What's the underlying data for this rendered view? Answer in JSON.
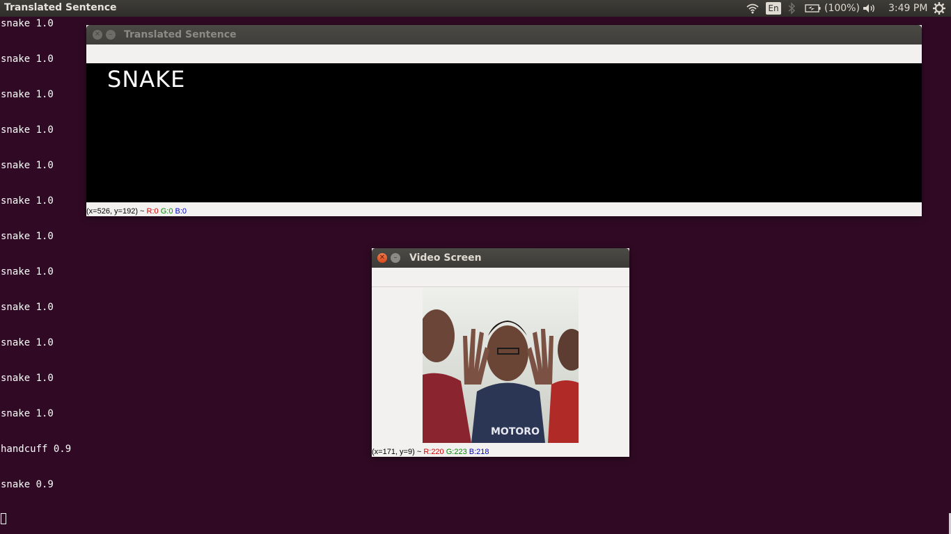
{
  "topbar": {
    "app_title": "Translated Sentence",
    "lang": "En",
    "battery_text": "(100%)",
    "clock": "3:49 PM",
    "icons": [
      "wifi-icon",
      "keyboard-layout-indicator",
      "bluetooth-icon",
      "battery-icon",
      "volume-icon",
      "gear-icon"
    ]
  },
  "terminal": {
    "lines": [
      "snake 1.0",
      "snake 1.0",
      "snake 1.0",
      "snake 1.0",
      "snake 1.0",
      "snake 1.0",
      "snake 1.0",
      "snake 1.0",
      "snake 1.0",
      "snake 1.0",
      "snake 1.0",
      "snake 1.0",
      "handcuff 0.9",
      "snake 0.9"
    ]
  },
  "translated_window": {
    "title": "Translated Sentence",
    "sentence": "SNAKE",
    "status": {
      "coords": "(x=526, y=192) ~",
      "r": "R:0",
      "g": "G:0",
      "b": "B:0"
    }
  },
  "video_window": {
    "title": "Video Screen",
    "shirt_text": "MOTORO",
    "status": {
      "coords": "(x=171, y=9) ~",
      "r": "R:220",
      "g": "G:223",
      "b": "B:218"
    }
  },
  "colors": {
    "desktop": "#300a24",
    "panel": "#3c3b37",
    "window_bg": "#f2f1f0",
    "close_button": "#e05a2b"
  }
}
